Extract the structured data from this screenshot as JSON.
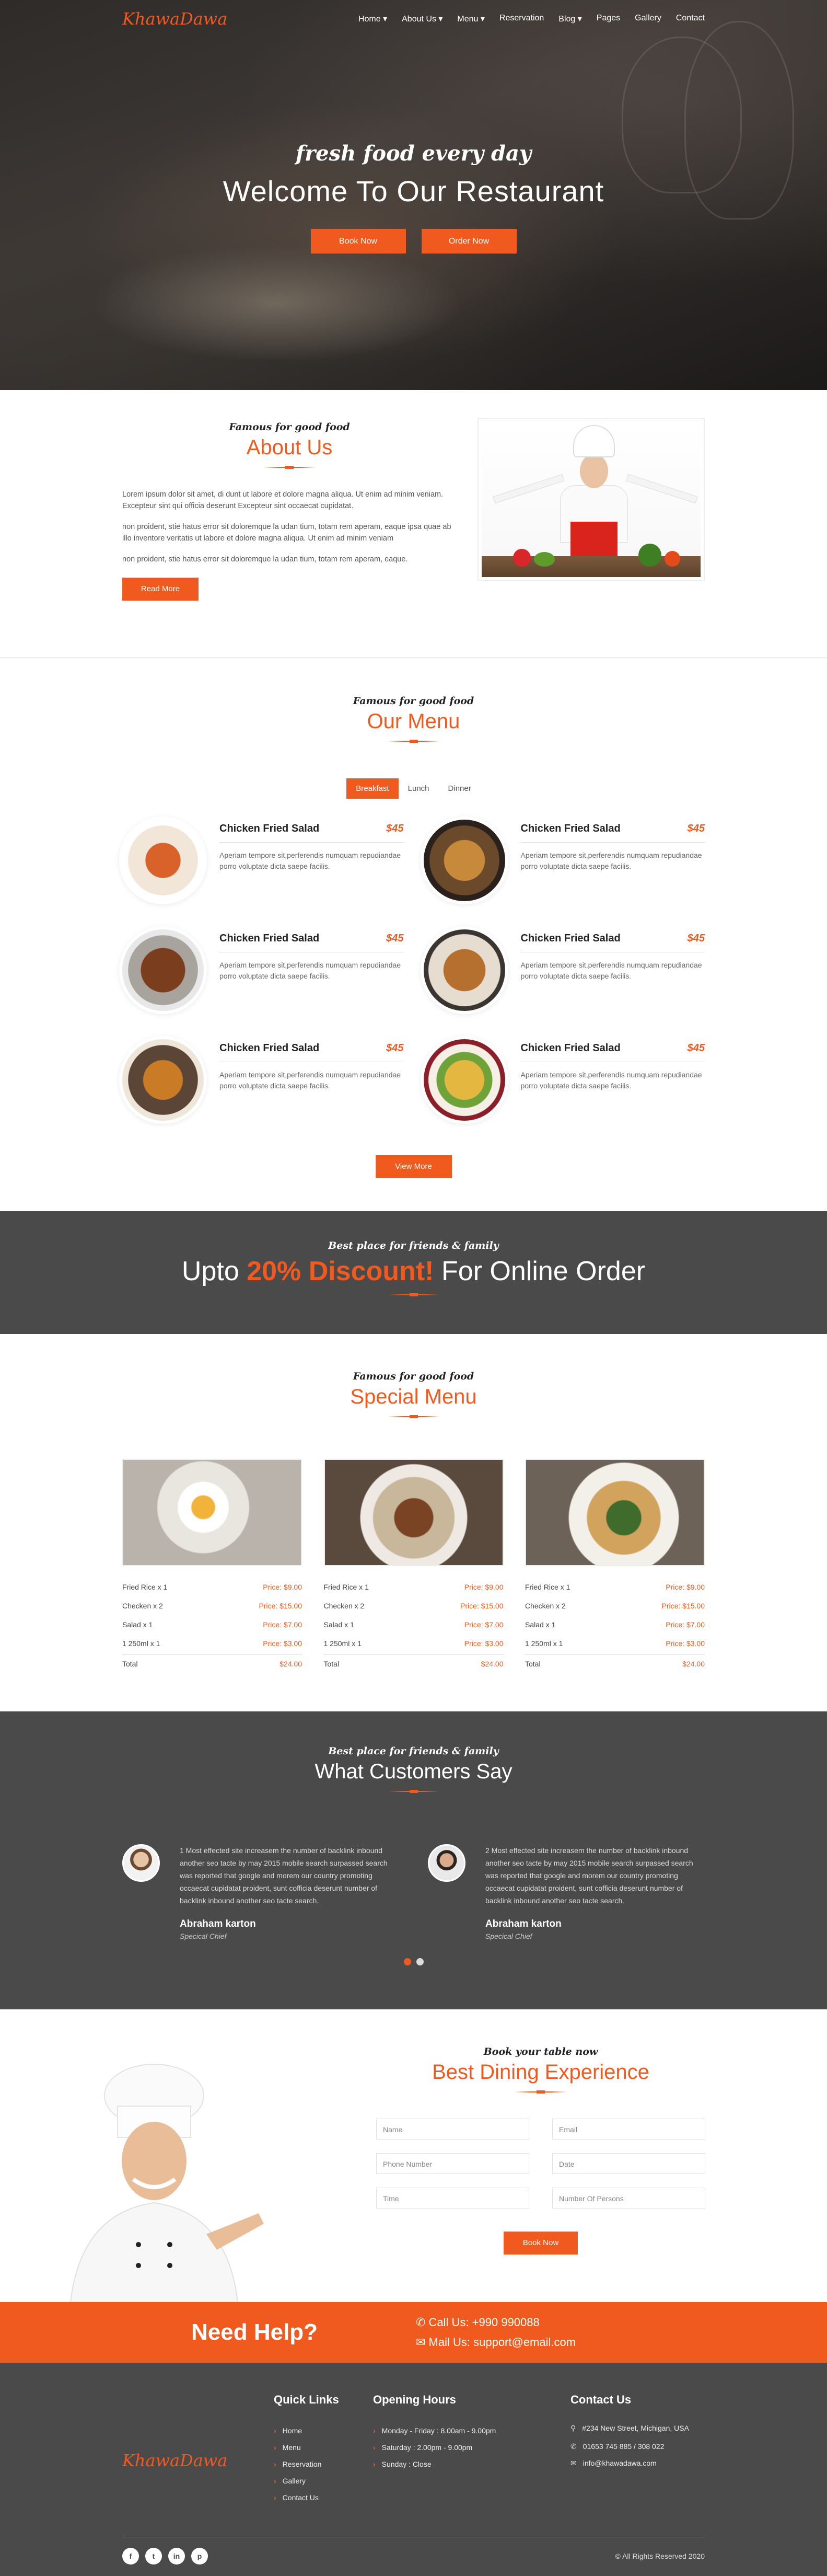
{
  "brand": {
    "logo": "KhawaDawa",
    "accent": "#f15a1f",
    "dark": "#4a4a4a"
  },
  "nav": {
    "items": [
      "Home ▾",
      "About Us ▾",
      "Menu ▾",
      "Reservation",
      "Blog ▾",
      "Pages",
      "Gallery",
      "Contact"
    ]
  },
  "hero": {
    "tagline": "fresh food every day",
    "title": "Welcome To Our Restaurant",
    "book_label": "Book Now",
    "order_label": "Order Now"
  },
  "about": {
    "sub": "Famous for good food",
    "title": "About Us",
    "paragraphs": [
      "Lorem ipsum dolor sit amet, di dunt ut labore et dolore magna aliqua. Ut enim ad minim veniam. Excepteur sint qui officia deserunt Excepteur sint occaecat cupidatat.",
      "non proident, stie hatus error sit doloremque la udan tium, totam rem aperam, eaque ipsa quae ab illo inventore veritatis ut labore et dolore magna aliqua. Ut enim ad minim veniam",
      "non proident, stie hatus error sit doloremque la udan tium, totam rem aperam, eaque."
    ],
    "button": "Read More"
  },
  "menu": {
    "sub": "Famous for good food",
    "title": "Our Menu",
    "tabs": [
      "Breakfast",
      "Lunch",
      "Dinner"
    ],
    "active_tab": "Breakfast",
    "items": [
      {
        "name": "Chicken Fried Salad",
        "price": "$45",
        "desc": "Aperiam tempore sit,perferendis numquam repudiandae porro voluptate dicta saepe facilis."
      },
      {
        "name": "Chicken Fried Salad",
        "price": "$45",
        "desc": "Aperiam tempore sit,perferendis numquam repudiandae porro voluptate dicta saepe facilis."
      },
      {
        "name": "Chicken Fried Salad",
        "price": "$45",
        "desc": "Aperiam tempore sit,perferendis numquam repudiandae porro voluptate dicta saepe facilis."
      },
      {
        "name": "Chicken Fried Salad",
        "price": "$45",
        "desc": "Aperiam tempore sit,perferendis numquam repudiandae porro voluptate dicta saepe facilis."
      },
      {
        "name": "Chicken Fried Salad",
        "price": "$45",
        "desc": "Aperiam tempore sit,perferendis numquam repudiandae porro voluptate dicta saepe facilis."
      },
      {
        "name": "Chicken Fried Salad",
        "price": "$45",
        "desc": "Aperiam tempore sit,perferendis numquam repudiandae porro voluptate dicta saepe facilis."
      }
    ],
    "view_more": "View More"
  },
  "discount": {
    "sub": "Best place for friends & family",
    "pre": "Upto ",
    "highlight": "20% Discount!",
    "post": " For Online Order"
  },
  "special": {
    "sub": "Famous for good food",
    "title": "Special Menu",
    "cards": [
      {
        "lines": [
          [
            "Fried Rice x 1",
            "Price: $9.00"
          ],
          [
            "Checken x 2",
            "Price: $15.00"
          ],
          [
            "Salad x 1",
            "Price: $7.00"
          ],
          [
            "1 250ml x 1",
            "Price: $3.00"
          ]
        ],
        "total": [
          "Total",
          "$24.00"
        ]
      },
      {
        "lines": [
          [
            "Fried Rice x 1",
            "Price: $9.00"
          ],
          [
            "Checken x 2",
            "Price: $15.00"
          ],
          [
            "Salad x 1",
            "Price: $7.00"
          ],
          [
            "1 250ml x 1",
            "Price: $3.00"
          ]
        ],
        "total": [
          "Total",
          "$24.00"
        ]
      },
      {
        "lines": [
          [
            "Fried Rice x 1",
            "Price: $9.00"
          ],
          [
            "Checken x 2",
            "Price: $15.00"
          ],
          [
            "Salad x 1",
            "Price: $7.00"
          ],
          [
            "1 250ml x 1",
            "Price: $3.00"
          ]
        ],
        "total": [
          "Total",
          "$24.00"
        ]
      }
    ]
  },
  "testimonials": {
    "sub": "Best place for friends & family",
    "title": "What Customers Say",
    "items": [
      {
        "text": "1 Most effected site increasem the number of backlink inbound another seo tacte by may 2015 mobile search surpassed search was reported that google and morem our country promoting occaecat cupidatat proident, sunt cofficia deserunt number of backlink inbound another seo tacte search.",
        "name": "Abraham karton",
        "role": "Specical Chief"
      },
      {
        "text": "2 Most effected site increasem the number of backlink inbound another seo tacte by may 2015 mobile search surpassed search was reported that google and morem our country promoting occaecat cupidatat proident, sunt cofficia deserunt number of backlink inbound another seo tacte search.",
        "name": "Abraham karton",
        "role": "Specical Chief"
      }
    ]
  },
  "booking": {
    "sub": "Book your table now",
    "title": "Best Dining Experience",
    "fields": [
      "Name",
      "Email",
      "Phone Number",
      "Date",
      "Time",
      "Number Of Persons"
    ],
    "button": "Book Now"
  },
  "help": {
    "title": "Need Help?",
    "call": "Call Us: +990 990088",
    "mail": "Mail Us: support@email.com"
  },
  "footer": {
    "logo": "KhawaDawa",
    "quick_title": "Quick Links",
    "quick_links": [
      "Home",
      "Menu",
      "Reservation",
      "Gallery",
      "Contact Us"
    ],
    "hours_title": "Opening Hours",
    "hours": [
      "Monday - Friday : 8.00am - 9.00pm",
      "Saturday : 2.00pm - 9.00pm",
      "Sunday : Close"
    ],
    "contact_title": "Contact Us",
    "address": "#234 New Street, Michigan, USA",
    "phone": "01653 745 885 / 308 022",
    "email": "info@khawadawa.com",
    "socials": [
      "facebook-icon",
      "twitter-icon",
      "linkedin-icon",
      "pinterest-icon"
    ],
    "copyright": "© All Rights Reserved 2020"
  }
}
